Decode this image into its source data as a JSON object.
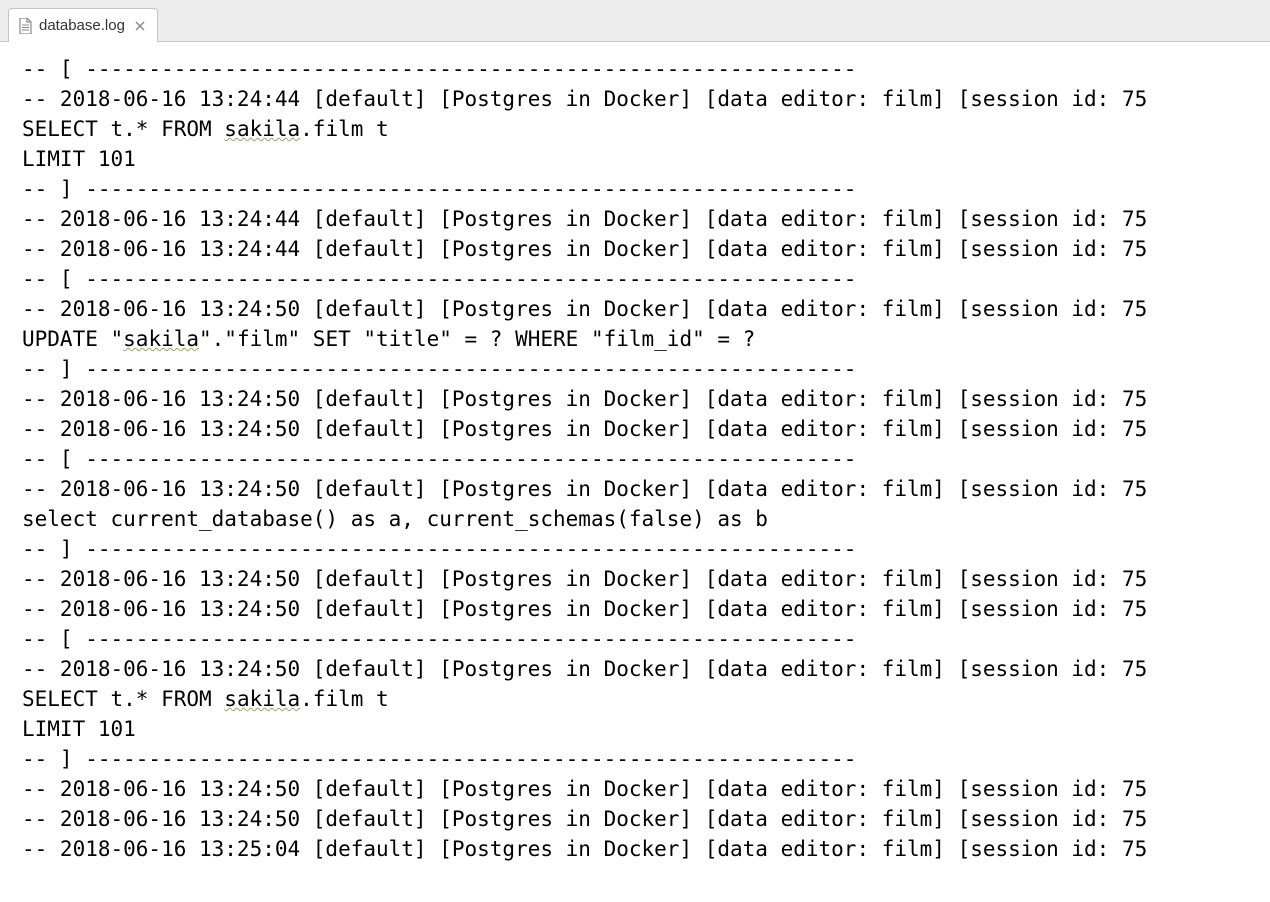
{
  "tab": {
    "label": "database.log"
  },
  "log": {
    "lines": [
      {
        "type": "sep-open",
        "text": "-- [ -------------------------------------------------------------"
      },
      {
        "type": "meta",
        "ts": "2018-06-16 13:24:44",
        "profile": "default",
        "conn": "Postgres in Docker",
        "src": "data editor: film",
        "sid": "75",
        "text": "-- 2018-06-16 13:24:44 [default] [Postgres in Docker] [data editor: film] [session id: 75"
      },
      {
        "type": "sql",
        "text": "SELECT t.* FROM sakila.film t",
        "wavy": "sakila"
      },
      {
        "type": "sql",
        "text": "LIMIT 101"
      },
      {
        "type": "sep-close",
        "text": "-- ] -------------------------------------------------------------"
      },
      {
        "type": "meta",
        "ts": "2018-06-16 13:24:44",
        "profile": "default",
        "conn": "Postgres in Docker",
        "src": "data editor: film",
        "sid": "75",
        "text": "-- 2018-06-16 13:24:44 [default] [Postgres in Docker] [data editor: film] [session id: 75"
      },
      {
        "type": "meta",
        "ts": "2018-06-16 13:24:44",
        "profile": "default",
        "conn": "Postgres in Docker",
        "src": "data editor: film",
        "sid": "75",
        "text": "-- 2018-06-16 13:24:44 [default] [Postgres in Docker] [data editor: film] [session id: 75"
      },
      {
        "type": "sep-open",
        "text": "-- [ -------------------------------------------------------------"
      },
      {
        "type": "meta",
        "ts": "2018-06-16 13:24:50",
        "profile": "default",
        "conn": "Postgres in Docker",
        "src": "data editor: film",
        "sid": "75",
        "text": "-- 2018-06-16 13:24:50 [default] [Postgres in Docker] [data editor: film] [session id: 75"
      },
      {
        "type": "sql",
        "text": "UPDATE \"sakila\".\"film\" SET \"title\" = ? WHERE \"film_id\" = ?",
        "wavy": "sakila"
      },
      {
        "type": "sep-close",
        "text": "-- ] -------------------------------------------------------------"
      },
      {
        "type": "meta",
        "ts": "2018-06-16 13:24:50",
        "profile": "default",
        "conn": "Postgres in Docker",
        "src": "data editor: film",
        "sid": "75",
        "text": "-- 2018-06-16 13:24:50 [default] [Postgres in Docker] [data editor: film] [session id: 75"
      },
      {
        "type": "meta",
        "ts": "2018-06-16 13:24:50",
        "profile": "default",
        "conn": "Postgres in Docker",
        "src": "data editor: film",
        "sid": "75",
        "text": "-- 2018-06-16 13:24:50 [default] [Postgres in Docker] [data editor: film] [session id: 75"
      },
      {
        "type": "sep-open",
        "text": "-- [ -------------------------------------------------------------"
      },
      {
        "type": "meta",
        "ts": "2018-06-16 13:24:50",
        "profile": "default",
        "conn": "Postgres in Docker",
        "src": "data editor: film",
        "sid": "75",
        "text": "-- 2018-06-16 13:24:50 [default] [Postgres in Docker] [data editor: film] [session id: 75"
      },
      {
        "type": "sql",
        "text": "select current_database() as a, current_schemas(false) as b"
      },
      {
        "type": "sep-close",
        "text": "-- ] -------------------------------------------------------------"
      },
      {
        "type": "meta",
        "ts": "2018-06-16 13:24:50",
        "profile": "default",
        "conn": "Postgres in Docker",
        "src": "data editor: film",
        "sid": "75",
        "text": "-- 2018-06-16 13:24:50 [default] [Postgres in Docker] [data editor: film] [session id: 75"
      },
      {
        "type": "meta",
        "ts": "2018-06-16 13:24:50",
        "profile": "default",
        "conn": "Postgres in Docker",
        "src": "data editor: film",
        "sid": "75",
        "text": "-- 2018-06-16 13:24:50 [default] [Postgres in Docker] [data editor: film] [session id: 75"
      },
      {
        "type": "sep-open",
        "text": "-- [ -------------------------------------------------------------"
      },
      {
        "type": "meta",
        "ts": "2018-06-16 13:24:50",
        "profile": "default",
        "conn": "Postgres in Docker",
        "src": "data editor: film",
        "sid": "75",
        "text": "-- 2018-06-16 13:24:50 [default] [Postgres in Docker] [data editor: film] [session id: 75"
      },
      {
        "type": "sql",
        "text": "SELECT t.* FROM sakila.film t",
        "wavy": "sakila"
      },
      {
        "type": "sql",
        "text": "LIMIT 101"
      },
      {
        "type": "sep-close",
        "text": "-- ] -------------------------------------------------------------"
      },
      {
        "type": "meta",
        "ts": "2018-06-16 13:24:50",
        "profile": "default",
        "conn": "Postgres in Docker",
        "src": "data editor: film",
        "sid": "75",
        "text": "-- 2018-06-16 13:24:50 [default] [Postgres in Docker] [data editor: film] [session id: 75"
      },
      {
        "type": "meta",
        "ts": "2018-06-16 13:24:50",
        "profile": "default",
        "conn": "Postgres in Docker",
        "src": "data editor: film",
        "sid": "75",
        "text": "-- 2018-06-16 13:24:50 [default] [Postgres in Docker] [data editor: film] [session id: 75"
      },
      {
        "type": "meta",
        "ts": "2018-06-16 13:25:04",
        "profile": "default",
        "conn": "Postgres in Docker",
        "src": "data editor: film",
        "sid": "75",
        "text": "-- 2018-06-16 13:25:04 [default] [Postgres in Docker] [data editor: film] [session id: 75"
      }
    ]
  }
}
